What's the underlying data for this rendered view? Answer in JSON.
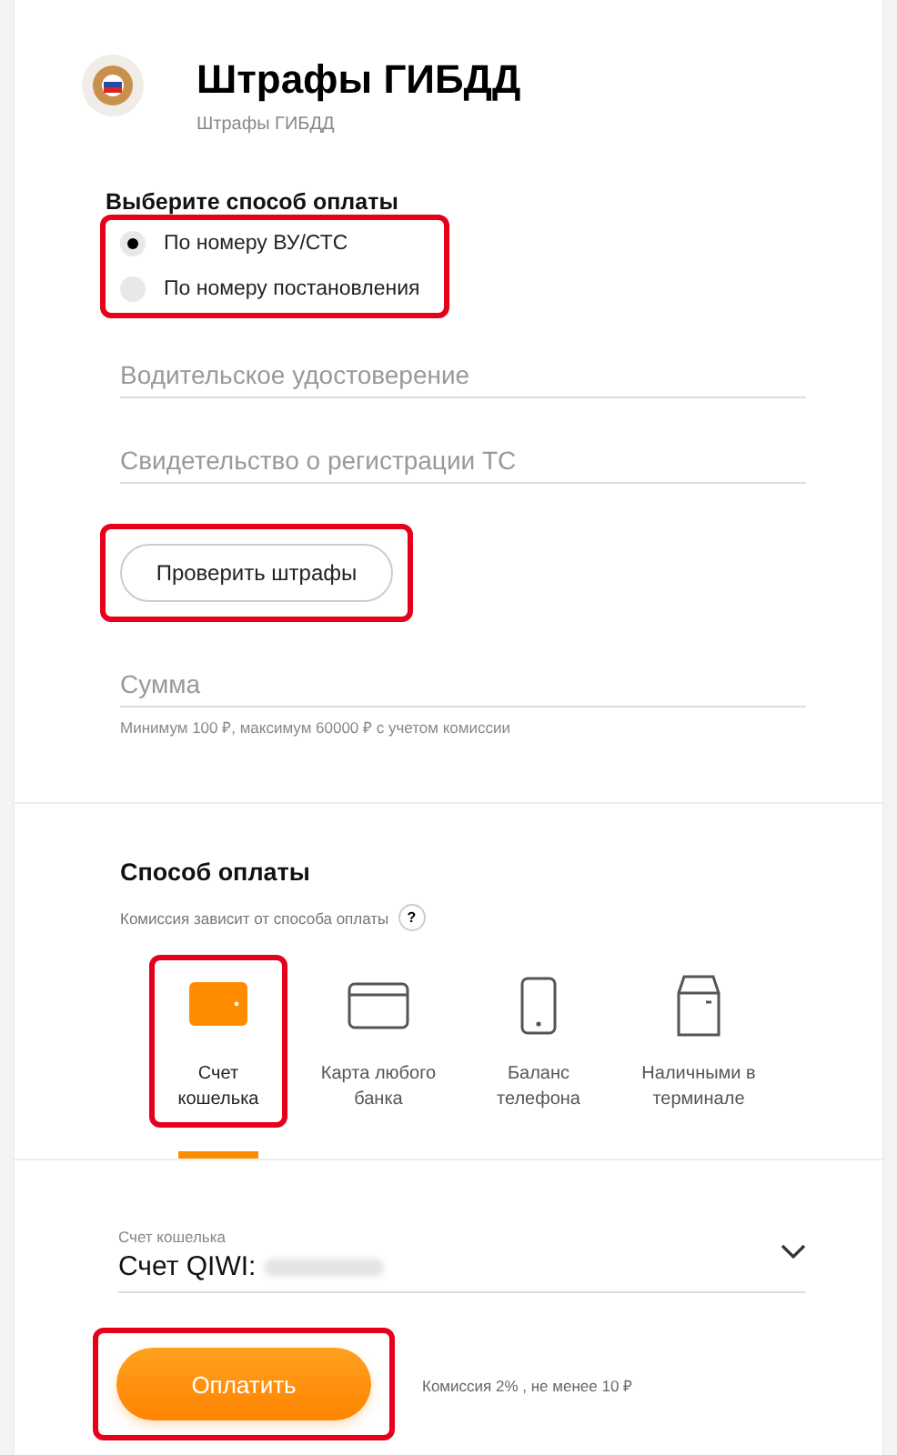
{
  "header": {
    "title": "Штрафы ГИБДД",
    "subtitle": "Штрафы ГИБДД"
  },
  "payment_by": {
    "heading": "Выберите способ оплаты",
    "highlighted": true,
    "options": [
      {
        "label": "По номеру ВУ/СТС",
        "selected": true
      },
      {
        "label": "По номеру постановления",
        "selected": false
      }
    ]
  },
  "fields": [
    {
      "placeholder": "Водительское удостоверение"
    },
    {
      "placeholder": "Свидетельство о регистрации ТС"
    }
  ],
  "check_button": {
    "label": "Проверить штрафы",
    "highlighted": true
  },
  "amount": {
    "placeholder": "Сумма",
    "hint": "Минимум 100 ₽, максимум 60000 ₽ с учетом комиссии"
  },
  "payment_method": {
    "heading": "Способ оплаты",
    "hint": "Комиссия зависит от способа оплаты",
    "help": "?",
    "methods": [
      {
        "kind": "wallet",
        "label": "Счет кошелька",
        "selected": true,
        "highlighted": true
      },
      {
        "kind": "card",
        "label": "Карта любого банка",
        "selected": false,
        "highlighted": false
      },
      {
        "kind": "phone",
        "label": "Баланс телефона",
        "selected": false,
        "highlighted": false
      },
      {
        "kind": "terminal",
        "label": "Наличными в терминале",
        "selected": false,
        "highlighted": false
      }
    ]
  },
  "account": {
    "label": "Счет кошелька",
    "value": "Счет QIWI:",
    "redacted": true
  },
  "pay_button": {
    "label": "Оплатить",
    "highlighted": true
  },
  "commission": "Комиссия 2% , не менее 10 ₽"
}
